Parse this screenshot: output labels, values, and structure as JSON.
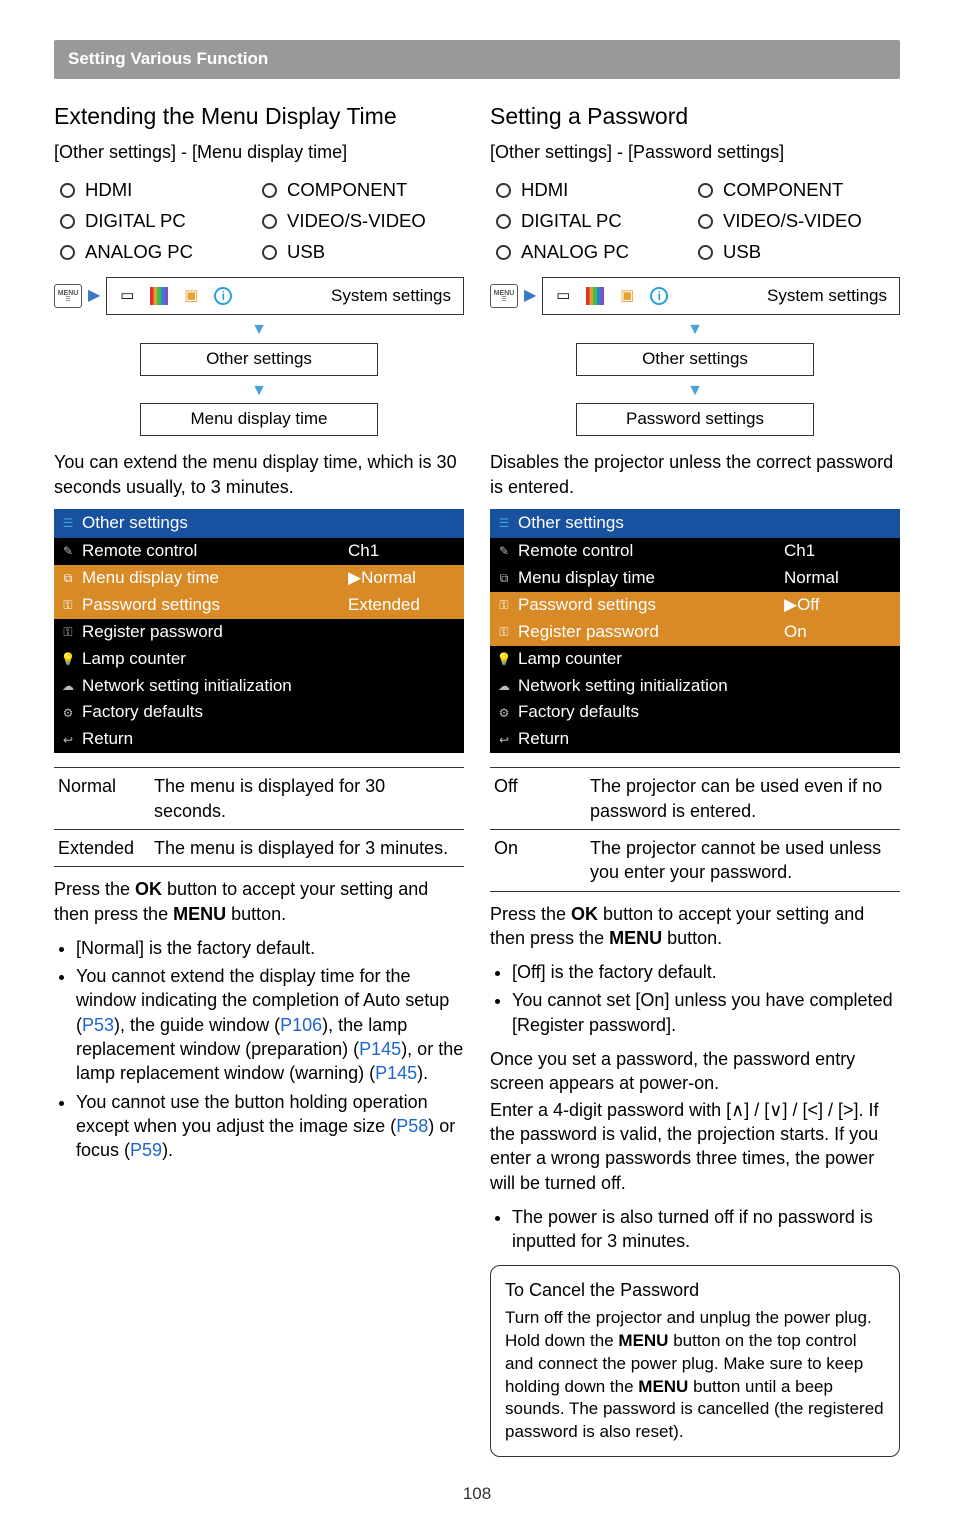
{
  "header": {
    "title": "Setting Various Function"
  },
  "page_number": "108",
  "radio_options": [
    "HDMI",
    "COMPONENT",
    "DIGITAL PC",
    "VIDEO/S-VIDEO",
    "ANALOG PC",
    "USB"
  ],
  "nav_top_label": "System settings",
  "left": {
    "title": "Extending the Menu Display Time",
    "breadcrumb": "[Other settings] - [Menu display time]",
    "nav": {
      "step2": "Other settings",
      "step3": "Menu display time"
    },
    "intro": "You can extend the menu display time, which is 30 seconds usually, to 3 minutes.",
    "osd": {
      "header": "Other settings",
      "rows": [
        {
          "icon": "✎",
          "label": "Remote control",
          "value": "Ch1",
          "sel": false
        },
        {
          "icon": "⧉",
          "label": "Menu display time",
          "value": "▶Normal",
          "sel": true
        },
        {
          "icon": "⚿",
          "label": "Password settings",
          "value": "Extended",
          "sel": true
        },
        {
          "icon": "⚿",
          "label": "Register password",
          "value": "",
          "sel": false
        },
        {
          "icon": "💡",
          "label": "Lamp counter",
          "value": "",
          "sel": false
        },
        {
          "icon": "☁",
          "label": "Network setting initialization",
          "value": "",
          "sel": false
        },
        {
          "icon": "⚙",
          "label": "Factory defaults",
          "value": "",
          "sel": false
        },
        {
          "icon": "↩",
          "label": "Return",
          "value": "",
          "sel": false
        }
      ]
    },
    "options": [
      {
        "name": "Normal",
        "desc": "The menu is displayed for 30 seconds."
      },
      {
        "name": "Extended",
        "desc": "The menu is displayed for 3 minutes."
      }
    ],
    "press_ok": "Press the OK button to accept your setting and then press the MENU button.",
    "bullets": [
      "[Normal] is the factory default.",
      "You cannot extend the display time for the window indicating the completion of Auto setup (P53), the guide window (P106), the lamp replacement window (preparation) (P145), or the lamp replacement window (warning) (P145).",
      "You cannot use the button holding operation except when you adjust the image size (P58) or focus (P59)."
    ],
    "refs": {
      "p53": "P53",
      "p106": "P106",
      "p145a": "P145",
      "p145b": "P145",
      "p58": "P58",
      "p59": "P59"
    }
  },
  "right": {
    "title": "Setting a Password",
    "breadcrumb": "[Other settings] - [Password settings]",
    "nav": {
      "step2": "Other settings",
      "step3": "Password settings"
    },
    "intro": "Disables the projector unless the correct password is entered.",
    "osd": {
      "header": "Other settings",
      "rows": [
        {
          "icon": "✎",
          "label": "Remote control",
          "value": "Ch1",
          "sel": false
        },
        {
          "icon": "⧉",
          "label": "Menu display time",
          "value": "Normal",
          "sel": false
        },
        {
          "icon": "⚿",
          "label": "Password settings",
          "value": "▶Off",
          "sel": true
        },
        {
          "icon": "⚿",
          "label": "Register password",
          "value": "On",
          "sel": true
        },
        {
          "icon": "💡",
          "label": "Lamp counter",
          "value": "",
          "sel": false
        },
        {
          "icon": "☁",
          "label": "Network setting initialization",
          "value": "",
          "sel": false
        },
        {
          "icon": "⚙",
          "label": "Factory defaults",
          "value": "",
          "sel": false
        },
        {
          "icon": "↩",
          "label": "Return",
          "value": "",
          "sel": false
        }
      ]
    },
    "options": [
      {
        "name": "Off",
        "desc": "The projector can be used even if no password is entered."
      },
      {
        "name": "On",
        "desc": "The projector cannot be used unless you enter your password."
      }
    ],
    "press_ok": "Press the OK button to accept your setting and then press the MENU button.",
    "bullets": [
      "[Off] is the factory default.",
      "You cannot set [On] unless you have completed [Register password]."
    ],
    "para1": "Once you set a password, the password entry screen appears at power-on.",
    "para2": "Enter a 4-digit password with [∧] / [∨] / [<] / [>]. If the password is valid, the projection starts. If you enter a wrong passwords three times, the power will be turned off.",
    "bullets2": [
      "The power is also turned off if no password is inputted for 3 minutes."
    ],
    "callout": {
      "title": "To Cancel the Password",
      "body": "Turn off the projector and unplug the power plug. Hold down the MENU button on the top control and connect the power plug. Make sure to keep holding down the MENU button until a beep sounds. The password is cancelled (the registered password is also reset)."
    }
  }
}
